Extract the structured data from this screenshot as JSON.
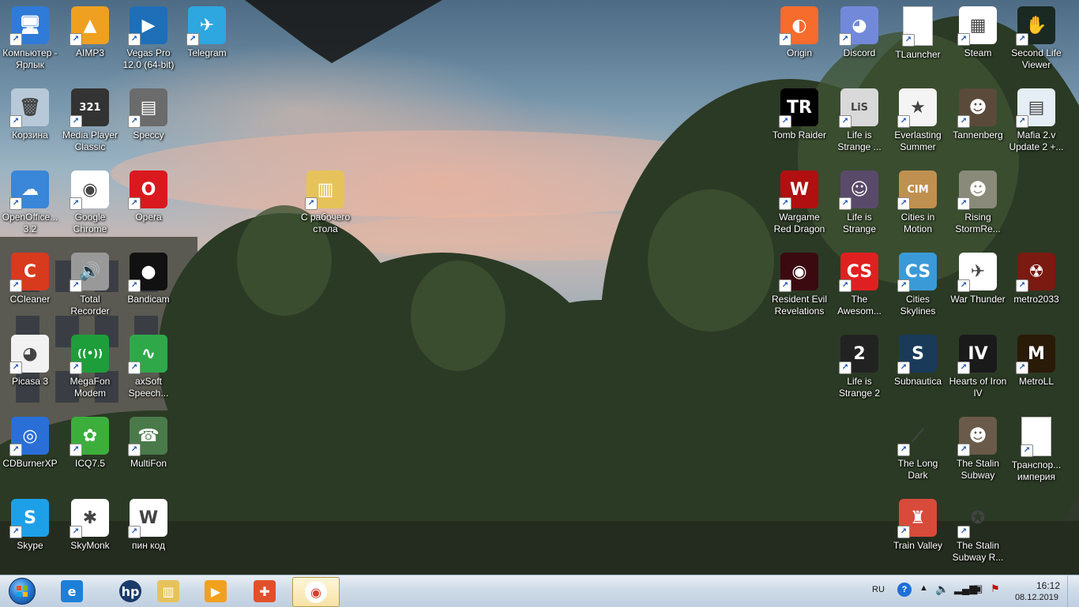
{
  "desktop": {
    "icons_left": [
      {
        "label": "Компьютер - Ярлык",
        "icon": "computer-icon",
        "color": "#2f7bd8",
        "glyph": "🖥"
      },
      {
        "label": "AIMP3",
        "icon": "aimp-icon",
        "color": "#f0a020",
        "glyph": "▲"
      },
      {
        "label": "Vegas Pro 12.0 (64-bit)",
        "icon": "vegas-icon",
        "color": "#1e6fb8",
        "glyph": "▶"
      },
      {
        "label": "Telegram",
        "icon": "telegram-icon",
        "color": "#2ea6e0",
        "glyph": "✈"
      },
      {
        "label": "Корзина",
        "icon": "recycle-bin-icon",
        "color": "#b7c9d8",
        "glyph": "🗑"
      },
      {
        "label": "Media Player Classic",
        "icon": "media-player-icon",
        "color": "#333333",
        "glyph": "321"
      },
      {
        "label": "Speccy",
        "icon": "speccy-icon",
        "color": "#6b6b6b",
        "glyph": "▤"
      },
      {
        "label": "OpenOffice... 3.2",
        "icon": "openoffice-icon",
        "color": "#3a86d8",
        "glyph": "☁"
      },
      {
        "label": "Google Chrome",
        "icon": "chrome-icon",
        "color": "#ffffff",
        "glyph": "◉"
      },
      {
        "label": "Opera",
        "icon": "opera-icon",
        "color": "#d9191e",
        "glyph": "O"
      },
      {
        "label": "CCleaner",
        "icon": "ccleaner-icon",
        "color": "#d83a1e",
        "glyph": "C"
      },
      {
        "label": "Total Recorder",
        "icon": "total-recorder-icon",
        "color": "#999999",
        "glyph": "🔊"
      },
      {
        "label": "Bandicam",
        "icon": "bandicam-icon",
        "color": "#111111",
        "glyph": "●"
      },
      {
        "label": "Picasa 3",
        "icon": "picasa-icon",
        "color": "#f2f2f2",
        "glyph": "◕"
      },
      {
        "label": "MegaFon Modem",
        "icon": "megafon-icon",
        "color": "#1e9e3a",
        "glyph": "((•))"
      },
      {
        "label": "axSoft Speech...",
        "icon": "axsoft-icon",
        "color": "#2fa84a",
        "glyph": "∿"
      },
      {
        "label": "CDBurnerXP",
        "icon": "cdburner-icon",
        "color": "#2a6fd8",
        "glyph": "◎"
      },
      {
        "label": "ICQ7.5",
        "icon": "icq-icon",
        "color": "#3cae3c",
        "glyph": "✿"
      },
      {
        "label": "MultiFon",
        "icon": "multifon-icon",
        "color": "#4a7a4a",
        "glyph": "☎"
      },
      {
        "label": "Skype",
        "icon": "skype-icon",
        "color": "#1ea0e8",
        "glyph": "S"
      },
      {
        "label": "SkyMonk",
        "icon": "skymonk-icon",
        "color": "#ffffff",
        "glyph": "✱"
      },
      {
        "label": "пин код",
        "icon": "word-document-icon",
        "color": "#ffffff",
        "glyph": "W"
      },
      {
        "label": "С рабочего стола",
        "icon": "folder-icon",
        "color": "#e6c35a",
        "glyph": "▥"
      }
    ],
    "icons_right": [
      {
        "label": "Origin",
        "icon": "origin-icon",
        "color": "#f56c2d",
        "glyph": "◐"
      },
      {
        "label": "Discord",
        "icon": "discord-icon",
        "color": "#7289da",
        "glyph": "◕"
      },
      {
        "label": "TLauncher",
        "icon": "tlauncher-icon",
        "color": "#ffffff",
        "glyph": ""
      },
      {
        "label": "Steam",
        "icon": "steam-icon",
        "color": "#ffffff",
        "glyph": "▦"
      },
      {
        "label": "Second Life Viewer",
        "icon": "second-life-icon",
        "color": "#1a2a22",
        "glyph": "✋"
      },
      {
        "label": "Tomb Raider",
        "icon": "tomb-raider-icon",
        "color": "#000000",
        "glyph": "TR"
      },
      {
        "label": "Life is Strange ...",
        "icon": "life-is-strange-icon",
        "color": "#d9d9d9",
        "glyph": "LiS"
      },
      {
        "label": "Everlasting Summer",
        "icon": "everlasting-summer-icon",
        "color": "#f4f4f4",
        "glyph": "★"
      },
      {
        "label": "Tannenberg",
        "icon": "tannenberg-icon",
        "color": "#5a4a3a",
        "glyph": "☻"
      },
      {
        "label": "Mafia 2.v Update 2 +...",
        "icon": "mafia-icon",
        "color": "#e6eef5",
        "glyph": "▤"
      },
      {
        "label": "Wargame Red Dragon",
        "icon": "wargame-icon",
        "color": "#b01010",
        "glyph": "W"
      },
      {
        "label": "Life is Strange",
        "icon": "life-is-strange-2-icon",
        "color": "#5a4a6a",
        "glyph": "☺"
      },
      {
        "label": "Cities in Motion",
        "icon": "cities-in-motion-icon",
        "color": "#c09050",
        "glyph": "CIM"
      },
      {
        "label": "Rising StormRe...",
        "icon": "rising-storm-icon",
        "color": "#8a8a7a",
        "glyph": "☻"
      },
      {
        "label": "Resident Evil Revelations",
        "icon": "resident-evil-icon",
        "color": "#3a0a10",
        "glyph": "◉"
      },
      {
        "label": "The Awesom...",
        "icon": "awesomenauts-icon",
        "color": "#e02020",
        "glyph": "CS"
      },
      {
        "label": "Cities Skylines",
        "icon": "cities-skylines-icon",
        "color": "#3a9ad8",
        "glyph": "CS"
      },
      {
        "label": "War Thunder",
        "icon": "war-thunder-icon",
        "color": "#ffffff",
        "glyph": "✈"
      },
      {
        "label": "metro2033",
        "icon": "metro2033-icon",
        "color": "#7a1a10",
        "glyph": "☢"
      },
      {
        "label": "Life is Strange 2",
        "icon": "life-is-strange-2b-icon",
        "color": "#222222",
        "glyph": "2"
      },
      {
        "label": "Subnautica",
        "icon": "subnautica-icon",
        "color": "#1a3a5a",
        "glyph": "S"
      },
      {
        "label": "Hearts of Iron IV",
        "icon": "hearts-of-iron-icon",
        "color": "#1a1a1a",
        "glyph": "IV"
      },
      {
        "label": "MetroLL",
        "icon": "metroll-icon",
        "color": "#2a1a08",
        "glyph": "M"
      },
      {
        "label": "The Long Dark",
        "icon": "the-long-dark-icon",
        "color": "transparent",
        "glyph": "⟋"
      },
      {
        "label": "The Stalin Subway",
        "icon": "stalin-subway-icon",
        "color": "#6a5a4a",
        "glyph": "☻"
      },
      {
        "label": "Транспор... империя",
        "icon": "transport-empire-icon",
        "color": "#ffffff",
        "glyph": ""
      },
      {
        "label": "Train Valley",
        "icon": "train-valley-icon",
        "color": "#d84a3a",
        "glyph": "♜"
      },
      {
        "label": "The Stalin Subway R...",
        "icon": "stalin-subway-r-icon",
        "color": "transparent",
        "glyph": "✪"
      }
    ]
  },
  "taskbar": {
    "pinned": [
      {
        "name": "internet-explorer-icon",
        "color": "#1e7fd8",
        "glyph": "e"
      },
      {
        "name": "hp-icon",
        "color": "#1a3a6a",
        "glyph": "hp"
      },
      {
        "name": "explorer-folder-icon",
        "color": "#e6c35a",
        "glyph": "▥"
      },
      {
        "name": "media-center-icon",
        "color": "#f2a020",
        "glyph": "▶"
      },
      {
        "name": "photo-app-icon",
        "color": "#e0502a",
        "glyph": "✚"
      },
      {
        "name": "chrome-taskbar-icon",
        "color": "#ffffff",
        "glyph": "◉"
      }
    ],
    "tray": {
      "language": "RU",
      "time": "16:12",
      "date": "08.12.2019"
    }
  }
}
